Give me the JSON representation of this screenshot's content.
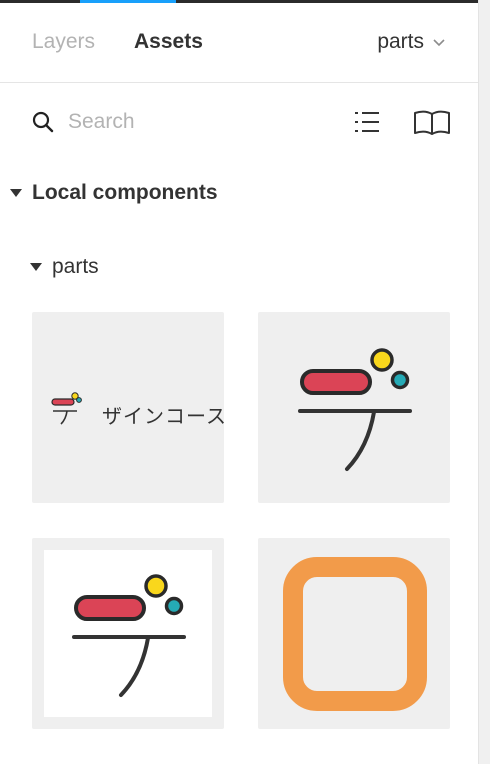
{
  "tabs": {
    "layers": "Layers",
    "assets": "Assets"
  },
  "page_select": {
    "value": "parts"
  },
  "search": {
    "placeholder": "Search"
  },
  "local_components": {
    "label": "Local components"
  },
  "group": {
    "label": "parts"
  },
  "components": {
    "logo_text": "ザインコース"
  },
  "colors": {
    "accent": "#18a0fb",
    "logo_red": "#db4456",
    "logo_yellow": "#f9d71c",
    "logo_teal": "#25aab5",
    "frame_orange": "#f29b4a"
  },
  "icons": [
    "search-icon",
    "list-view-icon",
    "library-book-icon",
    "chevron-down-icon"
  ]
}
